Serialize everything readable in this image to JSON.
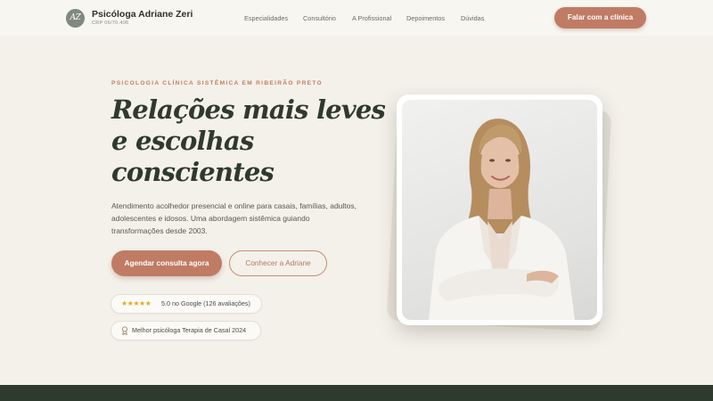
{
  "header": {
    "logo_initials": "AZ",
    "brand_name": "Psicóloga Adriane Zeri",
    "crp": "CRP 06/70.406",
    "nav": [
      "Especialidades",
      "Consultório",
      "A Profissional",
      "Depoimentos",
      "Dúvidas"
    ],
    "cta": "Falar com a clínica"
  },
  "hero": {
    "eyebrow": "PSICOLOGIA CLÍNICA SISTÊMICA EM RIBEIRÃO PRETO",
    "headline": [
      "Relações mais leves",
      "e escolhas",
      "conscientes"
    ],
    "lead": "Atendimento acolhedor presencial e online para casais, famílias, adultos, adolescentes e idosos. Uma abordagem sistêmica guiando transformações desde 2003.",
    "primary_button": "Agendar consulta agora",
    "secondary_button": "Conhecer a Adriane",
    "rating": {
      "stars": "★★★★★",
      "text": "5.0 no Google (126 avaliações)"
    },
    "award": "Melhor psicóloga Terapia de Casal 2024"
  },
  "photo": {
    "subject": "portrait-photo"
  },
  "colors": {
    "accent": "#c07b64",
    "dark_green": "#2e3a2d",
    "background": "#f4f1ea",
    "star": "#e9a820"
  }
}
